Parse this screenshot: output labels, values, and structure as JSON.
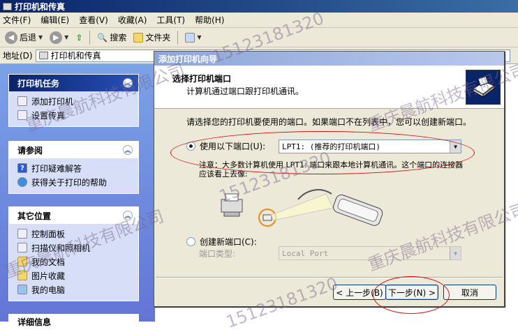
{
  "window": {
    "title": "打印机和传真"
  },
  "menu": [
    "文件(F)",
    "编辑(E)",
    "查看(V)",
    "收藏(A)",
    "工具(T)",
    "帮助(H)"
  ],
  "toolbar": {
    "back": "后退",
    "search": "搜索",
    "folders": "文件夹"
  },
  "address": {
    "label": "地址(D)",
    "value": "打印机和传真"
  },
  "left": {
    "printer_tasks": {
      "title": "打印机任务",
      "items": [
        "添加打印机",
        "设置传真"
      ]
    },
    "see_also": {
      "title": "请参阅",
      "items": [
        "打印疑难解答",
        "获得关于打印的帮助"
      ]
    },
    "other_places": {
      "title": "其它位置",
      "items": [
        "控制面板",
        "扫描仪和照相机",
        "我的文档",
        "图片收藏",
        "我的电脑"
      ]
    },
    "details_title": "详细信息"
  },
  "wizard": {
    "title": "添加打印机向导",
    "heading": "选择打印机端口",
    "subheading": "计算机通过端口跟打印机通讯。",
    "prompt": "请选择您的打印机要使用的端口。如果端口不在列表中，您可以创建新端口。",
    "use_port_label": "使用以下端口(U):",
    "use_port_value": "LPT1: (推荐的打印机端口)",
    "note": "注意：大多数计算机使用 LPT1: 端口来跟本地计算机通讯。这个端口的连接器应该看上去像:",
    "create_port_label": "创建新端口(C):",
    "port_type_label": "端口类型:",
    "port_type_value": "Local Port",
    "back_button": "< 上一步(B)",
    "next_button": "下一步(N) >",
    "cancel_button": "取消"
  },
  "watermarks": [
    "重庆晨航科技有限公司",
    "15123181320"
  ]
}
